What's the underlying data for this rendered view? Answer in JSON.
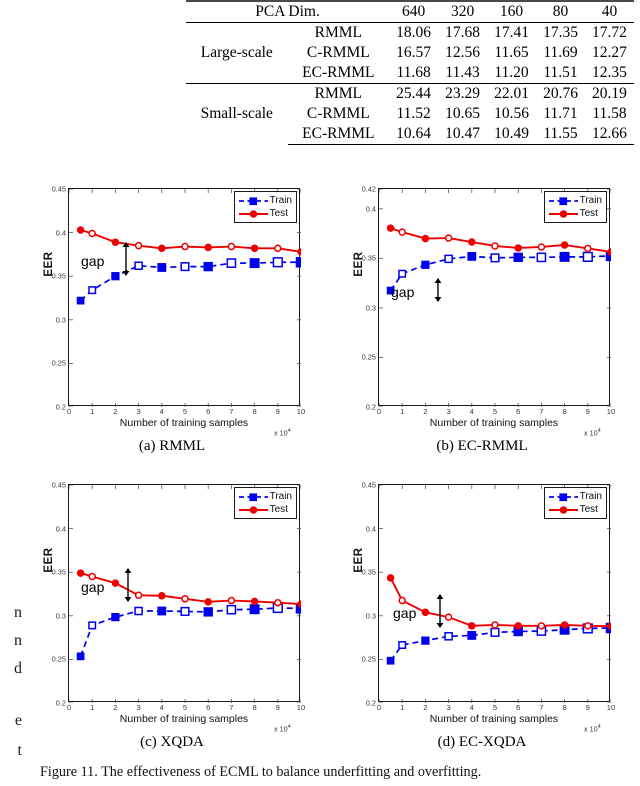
{
  "table": {
    "header": [
      "PCA Dim.",
      "640",
      "320",
      "160",
      "80",
      "40"
    ],
    "groups": [
      {
        "name": "Large-scale",
        "rows": [
          {
            "method": "RMML",
            "values": [
              "18.06",
              "17.68",
              "17.41",
              "17.35",
              "17.72"
            ]
          },
          {
            "method": "C-RMML",
            "values": [
              "16.57",
              "12.56",
              "11.65",
              "11.69",
              "12.27"
            ]
          },
          {
            "method": "EC-RMML",
            "values": [
              "11.68",
              "11.43",
              "11.20",
              "11.51",
              "12.35"
            ]
          }
        ]
      },
      {
        "name": "Small-scale",
        "rows": [
          {
            "method": "RMML",
            "values": [
              "25.44",
              "23.29",
              "22.01",
              "20.76",
              "20.19"
            ]
          },
          {
            "method": "C-RMML",
            "values": [
              "11.52",
              "10.65",
              "10.56",
              "11.71",
              "11.58"
            ]
          },
          {
            "method": "EC-RMML",
            "values": [
              "10.64",
              "10.47",
              "10.49",
              "11.55",
              "12.66"
            ]
          }
        ]
      }
    ]
  },
  "figure": {
    "caption": "Figure 11.  The effectiveness of ECML to balance underfitting and overfitting.",
    "legend": {
      "train": "Train",
      "test": "Test"
    },
    "axis": {
      "xlabel": "Number of training samples",
      "ylabel": "EER",
      "xmultiplier": "x 10",
      "xmultiplier_exp": "4"
    },
    "gap_label": "gap",
    "colors": {
      "train": "#0000ee",
      "test": "#ee0000",
      "axis": "#1a1a1a"
    },
    "margin_fragments": [
      "n",
      "n",
      "d",
      "e",
      "t"
    ]
  },
  "chart_data": [
    {
      "type": "line",
      "panel": "a",
      "title": "(a) RMML",
      "xlabel": "Number of training samples",
      "ylabel": "EER",
      "xlim": [
        0,
        10
      ],
      "ylim": [
        0.2,
        0.45
      ],
      "xticks": [
        0,
        1,
        2,
        3,
        4,
        5,
        6,
        7,
        8,
        9,
        10
      ],
      "yticks": [
        0.2,
        0.25,
        0.3,
        0.35,
        0.4,
        0.45
      ],
      "x": [
        0.5,
        1,
        2,
        3,
        4,
        5,
        6,
        7,
        8,
        9,
        10
      ],
      "series": [
        {
          "name": "Train",
          "values": [
            0.322,
            0.334,
            0.35,
            0.362,
            0.36,
            0.361,
            0.361,
            0.365,
            0.365,
            0.366,
            0.366
          ]
        },
        {
          "name": "Test",
          "values": [
            0.403,
            0.399,
            0.389,
            0.385,
            0.382,
            0.384,
            0.383,
            0.384,
            0.382,
            0.382,
            0.378
          ]
        }
      ],
      "annotations": [
        "gap"
      ],
      "legend_position": "top-right",
      "grid": false
    },
    {
      "type": "line",
      "panel": "b",
      "title": "(b) EC-RMML",
      "xlabel": "Number of training samples",
      "ylabel": "EER",
      "xlim": [
        0,
        10
      ],
      "ylim": [
        0.2,
        0.42
      ],
      "xticks": [
        0,
        1,
        2,
        3,
        4,
        5,
        6,
        7,
        8,
        9,
        10
      ],
      "yticks": [
        0.2,
        0.25,
        0.3,
        0.35,
        0.4,
        0.42
      ],
      "x": [
        0.5,
        1,
        2,
        3,
        4,
        5,
        6,
        7,
        8,
        9,
        10
      ],
      "series": [
        {
          "name": "Train",
          "values": [
            0.3175,
            0.3345,
            0.3435,
            0.3495,
            0.352,
            0.3505,
            0.351,
            0.351,
            0.3515,
            0.3515,
            0.3525
          ]
        },
        {
          "name": "Test",
          "values": [
            0.3805,
            0.3765,
            0.37,
            0.3705,
            0.3665,
            0.3625,
            0.3605,
            0.3615,
            0.3635,
            0.36,
            0.3565
          ]
        }
      ],
      "annotations": [
        "gap"
      ],
      "legend_position": "top-right",
      "grid": false
    },
    {
      "type": "line",
      "panel": "c",
      "title": "(c) XQDA",
      "xlabel": "Number of training samples",
      "ylabel": "EER",
      "xlim": [
        0,
        10
      ],
      "ylim": [
        0.2,
        0.45
      ],
      "xticks": [
        0,
        1,
        2,
        3,
        4,
        5,
        6,
        7,
        8,
        9,
        10
      ],
      "yticks": [
        0.2,
        0.25,
        0.3,
        0.35,
        0.4,
        0.45
      ],
      "x": [
        0.5,
        1,
        2,
        3,
        4,
        5,
        6,
        7,
        8,
        9,
        10
      ],
      "series": [
        {
          "name": "Train",
          "values": [
            0.2535,
            0.289,
            0.2985,
            0.3055,
            0.3055,
            0.305,
            0.3045,
            0.307,
            0.3075,
            0.309,
            0.3085
          ]
        },
        {
          "name": "Test",
          "values": [
            0.349,
            0.345,
            0.3375,
            0.3235,
            0.323,
            0.3195,
            0.316,
            0.3175,
            0.3165,
            0.315,
            0.3135
          ]
        }
      ],
      "annotations": [
        "gap"
      ],
      "legend_position": "top-right",
      "grid": false
    },
    {
      "type": "line",
      "panel": "d",
      "title": "(d) EC-XQDA",
      "xlabel": "Number of training samples",
      "ylabel": "EER",
      "xlim": [
        0,
        10
      ],
      "ylim": [
        0.2,
        0.45
      ],
      "xticks": [
        0,
        1,
        2,
        3,
        4,
        5,
        6,
        7,
        8,
        9,
        10
      ],
      "yticks": [
        0.2,
        0.25,
        0.3,
        0.35,
        0.4,
        0.45
      ],
      "x": [
        0.5,
        1,
        2,
        3,
        4,
        5,
        6,
        7,
        8,
        9,
        10
      ],
      "series": [
        {
          "name": "Train",
          "values": [
            0.2485,
            0.2665,
            0.2715,
            0.2765,
            0.2775,
            0.281,
            0.282,
            0.2825,
            0.284,
            0.2855,
            0.286
          ]
        },
        {
          "name": "Test",
          "values": [
            0.3435,
            0.3175,
            0.304,
            0.2985,
            0.2885,
            0.2895,
            0.2885,
            0.2885,
            0.2895,
            0.2885,
            0.288
          ]
        }
      ],
      "annotations": [
        "gap"
      ],
      "legend_position": "top-right",
      "grid": false
    }
  ]
}
